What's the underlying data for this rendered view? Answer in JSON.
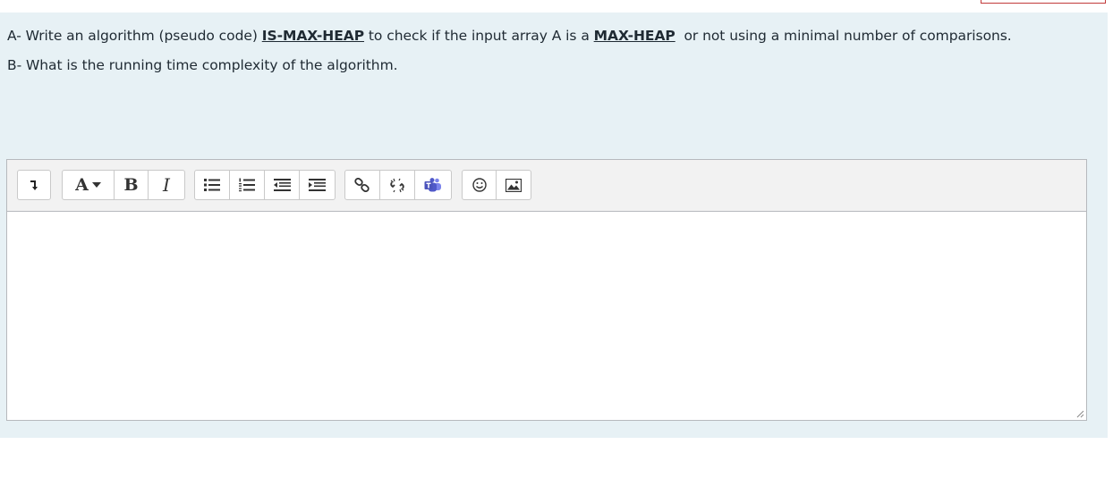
{
  "question": {
    "line_a": {
      "prefix": "A- Write an algorithm (pseudo code) ",
      "term1": "IS-MAX-HEAP",
      "middle": " to check if the input array A is a ",
      "term2": "MAX-HEAP",
      "suffix": "  or not using a minimal number of comparisons."
    },
    "line_b": "B- What is the running time complexity of the algorithm."
  },
  "editor": {
    "answer_text": "",
    "toolbar": {
      "collapse": {
        "icon": "arrow-down-icon"
      },
      "font_color": {
        "label": "A",
        "icon": "caret-down-icon"
      },
      "bold": {
        "label": "B"
      },
      "italic": {
        "label": "I"
      },
      "lists": [
        "unordered-list-icon",
        "ordered-list-icon",
        "outdent-icon",
        "indent-icon"
      ],
      "links": [
        "link-icon",
        "unlink-icon",
        "teams-icon"
      ],
      "media": [
        "emoji-icon",
        "image-icon"
      ]
    },
    "accent": "#c23a3a"
  }
}
